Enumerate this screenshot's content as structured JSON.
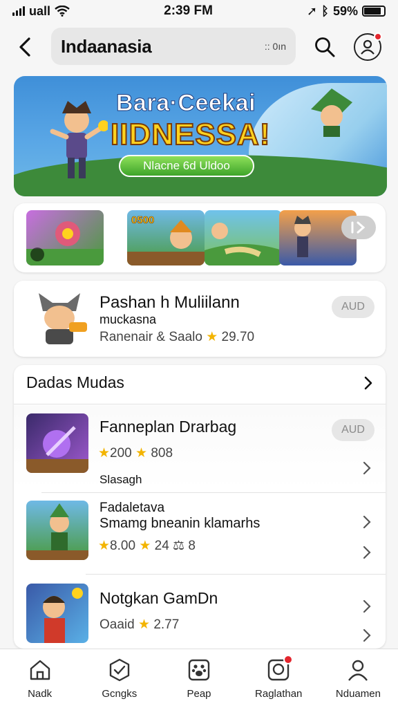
{
  "status_bar": {
    "carrier": "uall",
    "time": "2:39 FM",
    "battery": "59%"
  },
  "header": {
    "search_value": "Indaanasia",
    "search_meta": ":: 0ın"
  },
  "banner": {
    "title": "Bara·Ceekai",
    "subtitle": "IIDNESSA!",
    "button_label": "Nlacne 6d Uldoo"
  },
  "carousel": {
    "items": [
      {
        "label": "",
        "bg": "#7b3fa8"
      },
      {
        "label": "0500",
        "bg": "#4a9a3d"
      },
      {
        "label": "",
        "bg": "#5db0e0"
      },
      {
        "label": "",
        "bg": "#f08f3d"
      }
    ],
    "next_label": "I>"
  },
  "featured": {
    "title": "Pashan h Muliilann",
    "subtitle": "muckasna",
    "rating_text": "Ranenair & Saalo",
    "rating_value": "29.70",
    "button_label": "AUD"
  },
  "section": {
    "heading": "Dadas Mudas",
    "apps": [
      {
        "title": "Fanneplan Drarbag",
        "rating_a": "200",
        "rating_b": "808",
        "note": "Slasagh",
        "button_label": "AUD"
      },
      {
        "title": "Fadaletava",
        "description": "Smamg bneanin klamarhs",
        "rating_a": "8.00",
        "rating_b": "24 ⚖ 8"
      },
      {
        "title": "Notgkan GamDn",
        "rating_text": "Oaaid",
        "rating_b": "2.77"
      }
    ]
  },
  "nav": {
    "items": [
      {
        "label": "Nadk"
      },
      {
        "label": "Gcngks"
      },
      {
        "label": "Peap"
      },
      {
        "label": "Raglathan"
      },
      {
        "label": "Nduamen"
      }
    ]
  },
  "colors": {
    "accent_green": "#3ea42a",
    "star": "#f3b400",
    "badge_red": "#e3262e"
  }
}
